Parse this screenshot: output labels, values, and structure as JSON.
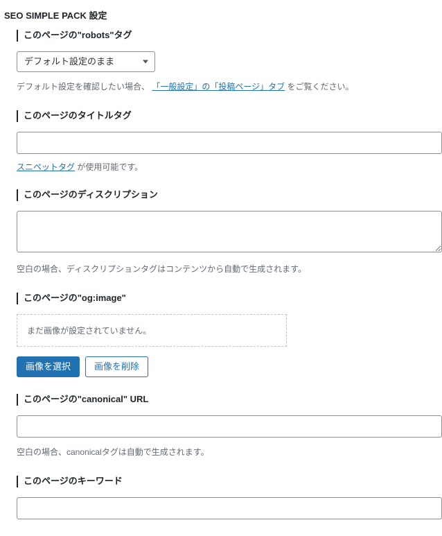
{
  "panel": {
    "title": "SEO SIMPLE PACK 設定"
  },
  "sections": {
    "robots": {
      "label": "このページの\"robots\"タグ",
      "select_value": "デフォルト設定のまま",
      "help_prefix": "デフォルト設定を確認したい場合、",
      "help_link": "「一般設定」の「投稿ページ」タブ",
      "help_suffix": " をご覧ください。"
    },
    "title": {
      "label": "このページのタイトルタグ",
      "value": "",
      "snippet_link": "スニペットタグ",
      "snippet_suffix": " が使用可能です。"
    },
    "description": {
      "label": "このページのディスクリプション",
      "value": "",
      "help": "空白の場合、ディスクリプションタグはコンテンツから自動で生成されます。"
    },
    "ogimage": {
      "label": "このページの\"og:image\"",
      "placeholder_text": "まだ画像が設定されていません。",
      "btn_select": "画像を選択",
      "btn_delete": "画像を削除"
    },
    "canonical": {
      "label": "このページの\"canonical\" URL",
      "value": "",
      "help": "空白の場合、canonicalタグは自動で生成されます。"
    },
    "keyword": {
      "label": "このページのキーワード",
      "value": ""
    }
  }
}
